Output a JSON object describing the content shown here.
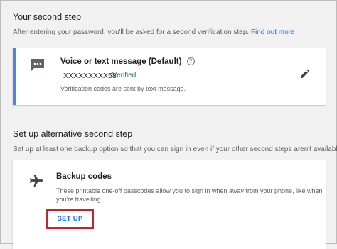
{
  "second_step": {
    "title": "Your second step",
    "description": "After entering your password, you'll be asked for a second verification step.",
    "link": "Find out more",
    "card": {
      "icon": "message-icon",
      "title": "Voice or text message (Default)",
      "help_symbol": "?",
      "phone": "XXXXXXXXX58",
      "status": "Verified",
      "note": "Verification codes are sent by text message.",
      "edit_icon": "pencil-icon"
    }
  },
  "alternative": {
    "title": "Set up alternative second step",
    "description": "Set up at least one backup option so that you can sign in even if your other second steps aren't available.",
    "card": {
      "icon": "airplane-icon",
      "title": "Backup codes",
      "note_line1": "These printable one-off passcodes allow you to sign in when away from your phone, like when",
      "note_line2": "you're travelling.",
      "button_label": "SET UP"
    }
  },
  "colors": {
    "accent": "#4285f4",
    "link": "#1a73e8",
    "verified": "#188038",
    "highlight_box": "#c0272d"
  }
}
